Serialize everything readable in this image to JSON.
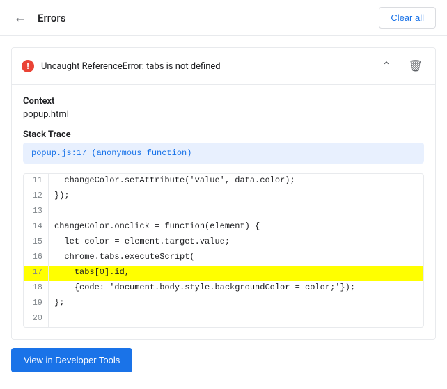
{
  "header": {
    "back_label": "←",
    "title": "Errors",
    "clear_all_label": "Clear all"
  },
  "error": {
    "icon_label": "!",
    "message": "Uncaught ReferenceError: tabs is not defined",
    "context_label": "Context",
    "context_value": "popup.html",
    "stack_trace_label": "Stack Trace",
    "stack_trace_value": "popup.js:17 (anonymous function)",
    "code_lines": [
      {
        "num": "11",
        "content": "  changeColor.setAttribute('value', data.color);",
        "highlighted": false
      },
      {
        "num": "12",
        "content": "});",
        "highlighted": false
      },
      {
        "num": "13",
        "content": "",
        "highlighted": false
      },
      {
        "num": "14",
        "content": "changeColor.onclick = function(element) {",
        "highlighted": false
      },
      {
        "num": "15",
        "content": "  let color = element.target.value;",
        "highlighted": false
      },
      {
        "num": "16",
        "content": "  chrome.tabs.executeScript(",
        "highlighted": false
      },
      {
        "num": "17",
        "content": "    tabs[0].id,",
        "highlighted": true
      },
      {
        "num": "18",
        "content": "    {code: 'document.body.style.backgroundColor = color;'});",
        "highlighted": false
      },
      {
        "num": "19",
        "content": "};",
        "highlighted": false
      },
      {
        "num": "20",
        "content": "",
        "highlighted": false
      }
    ]
  },
  "footer": {
    "dev_tools_label": "View in Developer Tools"
  }
}
